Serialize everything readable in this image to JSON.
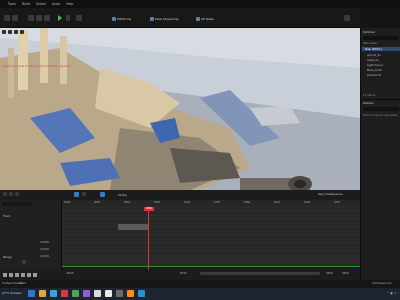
{
  "menu": [
    "Tools",
    "Build",
    "Select",
    "Actor",
    "Help"
  ],
  "toolbar": {
    "platforms_label": "Platforms",
    "pixel_streaming_label": "Pixel Streaming",
    "vp_roles_label": "VP Roles"
  },
  "viewport": {
    "warning_text": "Lighting needs to be rebuilt (multiple objects)"
  },
  "outliner": {
    "tab": "Outliner",
    "col_label": "Item Label",
    "rows": [
      "Main (Editor)",
      "ground_01",
      "mesh_01",
      "Light Source",
      "Base_mesh",
      "pCube1 01"
    ],
    "count": "17 actors"
  },
  "details": {
    "tab": "Details",
    "empty_text": "Select an object to view details."
  },
  "sequencer": {
    "fps": "30 fps",
    "sequence_name": "Seq_CineSequence",
    "tracks": [
      {
        "label": "Track",
        "value": ""
      },
      {
        "label": "",
        "value": ""
      },
      {
        "label": "",
        "value": "0.0000"
      },
      {
        "label": "",
        "value": "0.0000"
      },
      {
        "label": "Range",
        "value": "0.0000"
      },
      {
        "label": "",
        "value": ""
      },
      {
        "label": "",
        "value": ""
      }
    ],
    "ruler_ticks": [
      "0000",
      "0030",
      "0060",
      "0090",
      "0120",
      "0150",
      "0180",
      "0210",
      "0240",
      "0270"
    ],
    "playhead_frame": "0090",
    "start_tc": "-0015",
    "mid_tc": "0310",
    "end_tc_a": "0345",
    "end_tc_b": "0345"
  },
  "statusbar": {
    "left": "Content Drawer",
    "cmd": "Cmd",
    "right": "Command Line"
  },
  "taskbar": {
    "weather": "27°C Schedu",
    "colors": [
      "#2a78d6",
      "#e8a43a",
      "#3aa0e8",
      "#d23c3c",
      "#4aa84a",
      "#9b5bd6",
      "#ddd",
      "#e8e8e8",
      "#6a6a6a",
      "#ff8c1a",
      "#2b8fd6"
    ]
  }
}
